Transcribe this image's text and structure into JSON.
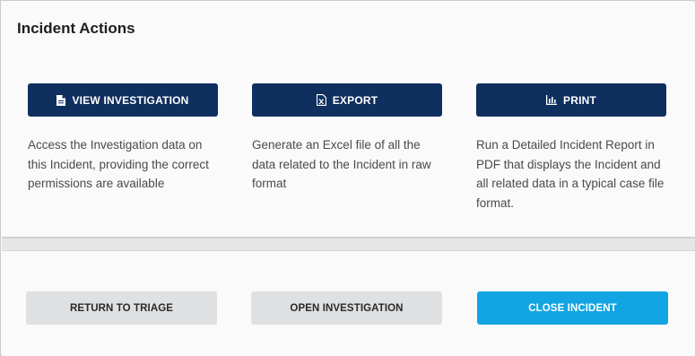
{
  "panel": {
    "title": "Incident Actions"
  },
  "actions": [
    {
      "label": "VIEW INVESTIGATION",
      "icon": "document-icon",
      "description": "Access the Investigation data on this Incident, providing the correct permissions are available"
    },
    {
      "label": "EXPORT",
      "icon": "excel-file-icon",
      "description": "Generate an Excel file of all the data related to the Incident in raw format"
    },
    {
      "label": "PRINT",
      "icon": "bar-chart-icon",
      "description": "Run a Detailed Incident Report in PDF that displays the Incident and all related data in a typical case file format."
    }
  ],
  "footer": {
    "return_label": "RETURN TO TRIAGE",
    "open_label": "OPEN INVESTIGATION",
    "close_label": "CLOSE INCIDENT"
  },
  "colors": {
    "action_button": "#0f2f5f",
    "primary_button": "#12a4e3",
    "secondary_button": "#dfe0e2"
  }
}
